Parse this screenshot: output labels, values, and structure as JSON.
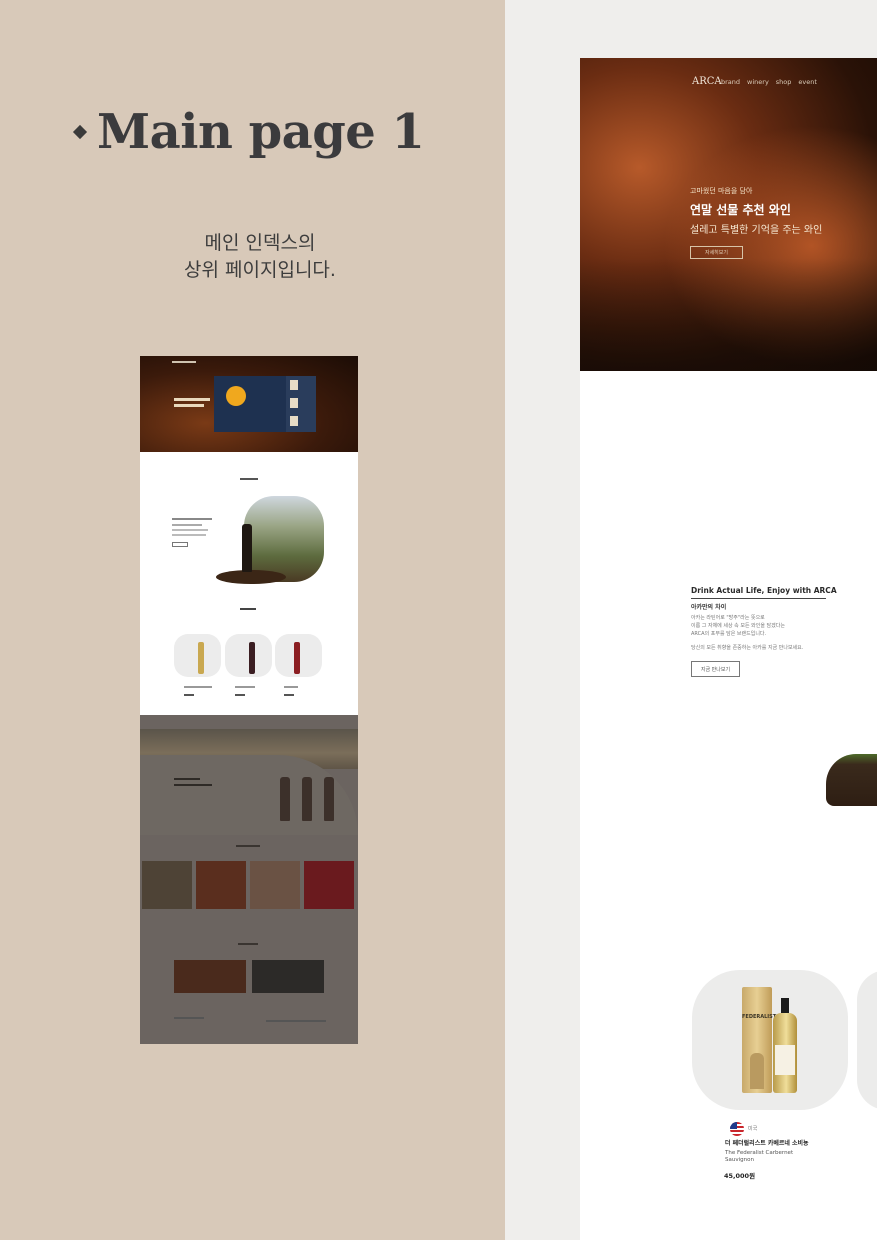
{
  "slide": {
    "heading": "Main page 1",
    "description_line1": "메인 인덱스의",
    "description_line2": "상위 페이지입니다."
  },
  "mockup": {
    "nav": {
      "logo": "ARCA",
      "links": [
        "brand",
        "winery",
        "shop",
        "event"
      ]
    },
    "hero": {
      "kicker": "고마웠던 마음을 담아",
      "title": "연말 선물 추천 와인",
      "subtitle": "설레고 특별한 기억을 주는 와인",
      "button": "자세히보기"
    },
    "about": {
      "title": "Drink Actual Life, Enjoy with ARCA",
      "subtitle": "아카만의 차이",
      "paragraph_lines": [
        "아카는 라틴어로 \"방주\"라는 뜻으로",
        "이름 그 자체에 세상 속 모든 와인을 담겠다는",
        "ARCA의 포부를 담은 브랜드입니다.",
        "당신의 모든 취향을 존중하는 아카를 지금 만나보세요."
      ],
      "button": "지금 만나보기"
    },
    "product": {
      "tube_label": "FEDERALIST",
      "country": "미국",
      "name_kr": "더 페더럴리스트 카베르네 소비뇽",
      "name_en": "The Federalist Carbernet Sauvignon",
      "price": "45,000원"
    }
  },
  "colors": {
    "left_panel": "#d8c9b9",
    "heading": "#3b3b3d",
    "hero_dark": "#2a1207",
    "accent_blue": "#1e3150",
    "accent_gold": "#f0a81e"
  }
}
